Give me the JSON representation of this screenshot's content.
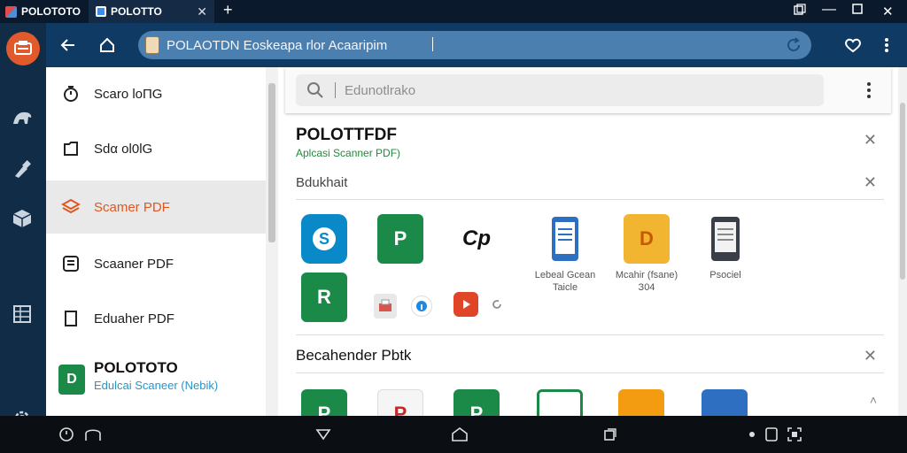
{
  "tabs": [
    {
      "label": "POLOTOTO"
    },
    {
      "label": "POLOTTO"
    }
  ],
  "addressbar": {
    "url": "POLAOTDN Eoskeapa rlor Acaaripim"
  },
  "sidebar": {
    "items": [
      {
        "label": "Scaro lоПG"
      },
      {
        "label": "Sdα ol0lG"
      },
      {
        "label": "Scamer PDF"
      },
      {
        "label": "Scaaner PDF"
      },
      {
        "label": "Eduaher PDF"
      }
    ],
    "brand": {
      "tile": "D",
      "title": "POLOTOTO",
      "subtitle": "Edulcai Scaneer (Nebik)"
    }
  },
  "search": {
    "placeholder": "Edunotlrako"
  },
  "section1": {
    "title": "POLOTTFDF",
    "subtitle": "Aplcasi Scanner PDF)",
    "label": "Bdukhait"
  },
  "apps": [
    {
      "letter": "S",
      "label": ""
    },
    {
      "letter": "P",
      "label": ""
    },
    {
      "letter": "Cp",
      "label": ""
    },
    {
      "letter": "",
      "label": "Lebeal Gcean\nTaicle"
    },
    {
      "letter": "D",
      "label": "Mcahir (fsane)\nЗ04"
    },
    {
      "letter": "",
      "label": "Psociel"
    },
    {
      "letter": "R",
      "label": ""
    }
  ],
  "section2": {
    "title": "Becahender Pbtk"
  },
  "colors": {
    "accent_orange": "#e0561f",
    "brand_blue": "#0f3a63",
    "excel_green": "#1b8a49",
    "sharepoint_teal": "#0a89c9"
  }
}
